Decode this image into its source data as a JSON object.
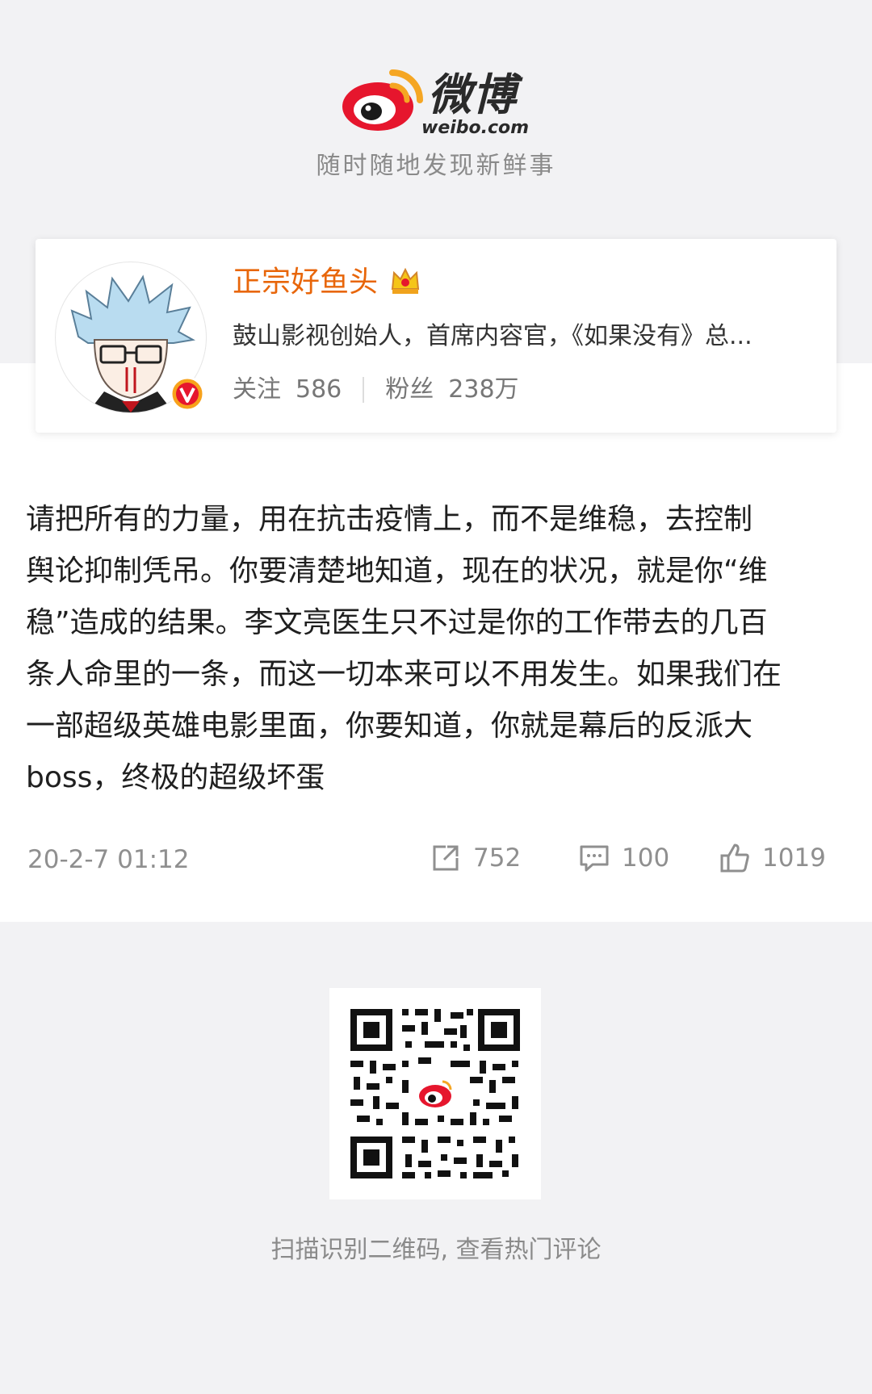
{
  "header": {
    "brand_cn": "微博",
    "brand_en": "weibo.com",
    "slogan": "随时随地发现新鲜事"
  },
  "user": {
    "name": "正宗好鱼头",
    "bio": "鼓山影视创始人，首席内容官，《如果没有》总...",
    "following_label": "关注",
    "following_count": "586",
    "followers_label": "粉丝",
    "followers_count": "238万",
    "verified_color": "#e8660a"
  },
  "post": {
    "lines": [
      "请把所有的力量，用在抗击疫情上，而不是维稳，去控制",
      "舆论抑制凭吊。你要清楚地知道，现在的状况，就是你“维",
      "稳”造成的结果。李文亮医生只不过是你的工作带去的几百",
      "条人命里的一条，而这一切本来可以不用发生。如果我们在",
      "一部超级英雄电影里面，你要知道，你就是幕后的反派大",
      "boss，终极的超级坏蛋"
    ],
    "time": "20-2-7 01:12",
    "reposts": "752",
    "comments": "100",
    "likes": "1019"
  },
  "footer": {
    "qr_caption": "扫描识别二维码, 查看热门评论"
  },
  "icons": [
    "weibo-logo-icon",
    "crown-icon",
    "verified-v-icon",
    "share-icon",
    "comment-icon",
    "like-icon",
    "qr-code"
  ],
  "colors": {
    "brand_red": "#e6162d",
    "brand_orange": "#f5a623",
    "name_orange": "#e8660a"
  }
}
